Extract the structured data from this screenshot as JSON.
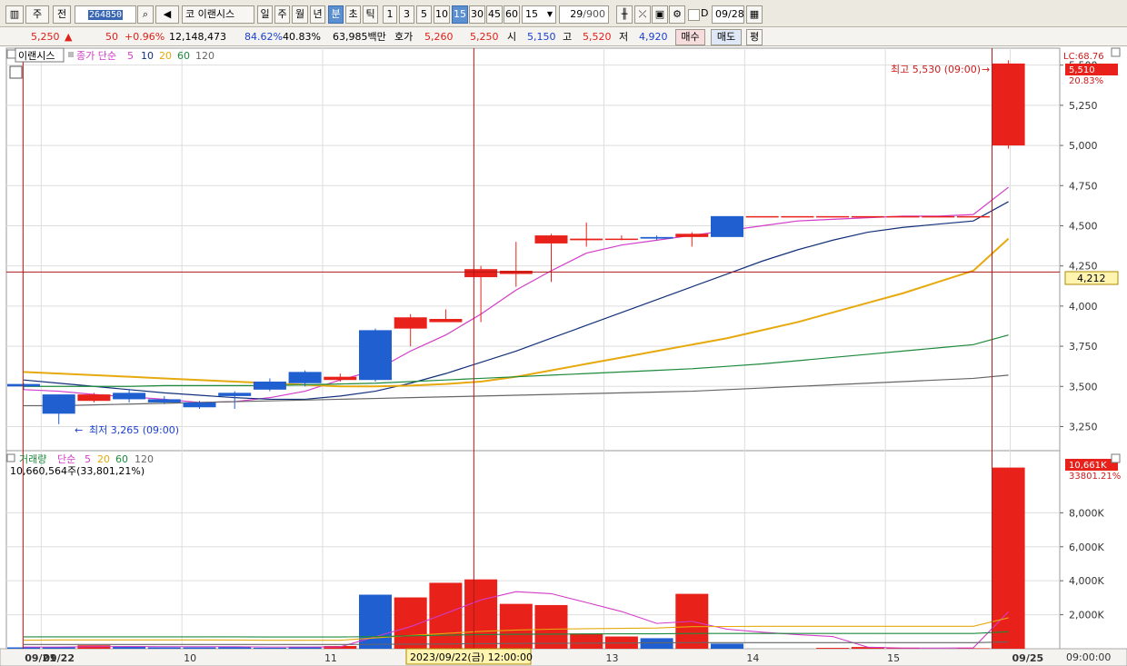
{
  "toolbar": {
    "market": "주",
    "prev_label": "전",
    "code": "264850",
    "company_prefix": "코",
    "company": "이랜시스",
    "periods": [
      "일",
      "주",
      "월",
      "년",
      "분",
      "초",
      "틱"
    ],
    "active_period": "분",
    "intervals": [
      "1",
      "3",
      "5",
      "10",
      "15",
      "30",
      "45",
      "60"
    ],
    "active_interval": "15",
    "interval_select": "15",
    "count": "29",
    "count_max": "/900",
    "d_label": "D",
    "date": "09/28"
  },
  "quote": {
    "price": "5,250",
    "arrow": "▲",
    "change": "50",
    "change_pct": "+0.96%",
    "volume": "12,148,473",
    "ratio1": "84.62%",
    "ratio2": "40.83%",
    "amount": "63,985백만",
    "bid_label": "호가",
    "ask_price": "5,260",
    "bid_price": "5,250",
    "open_label": "시",
    "open": "5,150",
    "high_label": "고",
    "high": "5,520",
    "low_label": "저",
    "low": "4,920",
    "buy": "매수",
    "sell": "매도",
    "avg": "평"
  },
  "legend": {
    "price_name": "이랜시스",
    "price_ma_title": "종가 단순",
    "ma": [
      "5",
      "10",
      "20",
      "60",
      "120"
    ],
    "volume_name": "거래량",
    "volume_ma_title": "단순",
    "volume_ma": [
      "5",
      "20",
      "60",
      "120"
    ],
    "volume_info": "10,660,564주(33,801,21%)"
  },
  "annotations": {
    "high": "최고 5,530 (09:00)",
    "low": "최저 3,265 (09:00)",
    "lc": "LC:68.76",
    "price_tag": "5,510",
    "price_tag_pct": "20.83%",
    "crosshair_value": "4,212",
    "crosshair_time": "2023/09/22(금) 12:00:00",
    "volume_tag": "10,661K",
    "volume_tag_pct": "33801.21%",
    "time_axis_corner": "09:00:00"
  },
  "colors": {
    "up": "#e8211a",
    "down": "#1f5fd0",
    "ma5": "#d23cc8",
    "ma10": "#12307a",
    "ma20": "#e6a90e",
    "ma60": "#1d8a3c",
    "ma120": "#666666",
    "grid": "#dddddd",
    "crosshair": "#b01818"
  },
  "chart_data": [
    {
      "type": "candlestick",
      "title": "이랜시스 15분봉",
      "x": [
        "09/21 15:00",
        "09/22 09:00",
        "09/22 09:15",
        "09/22 09:30",
        "09/22 09:45",
        "09/22 10:00",
        "09/22 10:15",
        "09/22 10:30",
        "09/22 10:45",
        "09/22 11:00",
        "09/22 11:15",
        "09/22 11:30",
        "09/22 11:45",
        "09/22 12:00",
        "09/22 12:15",
        "09/22 12:30",
        "09/22 12:45",
        "09/22 13:00",
        "09/22 13:15",
        "09/22 13:30",
        "09/22 13:45",
        "09/22 14:00",
        "09/22 14:15",
        "09/22 14:30",
        "09/22 14:45",
        "09/22 15:00",
        "09/22 15:15",
        "09/22 15:30",
        "09/25 09:00"
      ],
      "open": [
        3515,
        3450,
        3410,
        3460,
        3420,
        3400,
        3460,
        3530,
        3590,
        3540,
        3850,
        3860,
        3900,
        4180,
        4200,
        4390,
        4410,
        4420,
        4430,
        4430,
        4560,
        4560,
        4560,
        4560,
        4560,
        4560,
        4560,
        4560,
        5000
      ],
      "close": [
        3500,
        3330,
        3450,
        3420,
        3400,
        3370,
        3440,
        3480,
        3520,
        3560,
        3540,
        3930,
        3920,
        4230,
        4220,
        4440,
        4420,
        4420,
        4420,
        4450,
        4430,
        4560,
        4560,
        4560,
        4560,
        4560,
        4560,
        4560,
        5510
      ],
      "high": [
        3520,
        3450,
        3460,
        3480,
        3440,
        3410,
        3470,
        3550,
        3600,
        3580,
        3860,
        3950,
        3980,
        4250,
        4400,
        4450,
        4520,
        4440,
        4440,
        4460,
        4560,
        4560,
        4560,
        4560,
        4560,
        4560,
        4560,
        4560,
        5530
      ],
      "low": [
        3480,
        3265,
        3400,
        3400,
        3390,
        3360,
        3360,
        3470,
        3500,
        3530,
        3530,
        3750,
        3900,
        3900,
        4120,
        4150,
        4370,
        4410,
        4410,
        4370,
        4430,
        4560,
        4560,
        4560,
        4560,
        4560,
        4560,
        4560,
        4980
      ],
      "ma": {
        "5": [
          3480,
          3470,
          3450,
          3435,
          3420,
          3400,
          3405,
          3430,
          3470,
          3540,
          3600,
          3720,
          3820,
          3950,
          4100,
          4220,
          4330,
          4380,
          4410,
          4440,
          4470,
          4500,
          4530,
          4540,
          4550,
          4560,
          4560,
          4570,
          4740
        ],
        "10": [
          3540,
          3520,
          3500,
          3480,
          3460,
          3445,
          3430,
          3420,
          3420,
          3440,
          3470,
          3520,
          3580,
          3650,
          3720,
          3800,
          3880,
          3960,
          4040,
          4120,
          4200,
          4280,
          4350,
          4410,
          4460,
          4490,
          4510,
          4530,
          4650
        ],
        "20": [
          3590,
          3580,
          3570,
          3560,
          3550,
          3540,
          3530,
          3520,
          3510,
          3500,
          3500,
          3505,
          3515,
          3530,
          3560,
          3600,
          3640,
          3680,
          3720,
          3760,
          3800,
          3850,
          3900,
          3960,
          4020,
          4080,
          4150,
          4220,
          4420
        ],
        "60": [
          3500,
          3500,
          3500,
          3500,
          3505,
          3505,
          3505,
          3505,
          3510,
          3515,
          3520,
          3530,
          3540,
          3550,
          3560,
          3570,
          3580,
          3590,
          3600,
          3610,
          3625,
          3640,
          3660,
          3680,
          3700,
          3720,
          3740,
          3760,
          3820
        ],
        "120": [
          3380,
          3380,
          3385,
          3390,
          3395,
          3400,
          3405,
          3410,
          3415,
          3420,
          3425,
          3430,
          3435,
          3440,
          3445,
          3450,
          3455,
          3460,
          3465,
          3470,
          3480,
          3490,
          3500,
          3510,
          3520,
          3530,
          3540,
          3550,
          3570
        ]
      },
      "xlabel": "",
      "ylabel": "",
      "ylim": [
        3100,
        5600
      ],
      "yticks": [
        "3,250",
        "3,500",
        "3,750",
        "4,000",
        "4,250",
        "4,500",
        "4,750",
        "5,000",
        "5,250",
        "5,500"
      ],
      "grid": true
    },
    {
      "type": "bar",
      "title": "거래량",
      "values": [
        80000,
        100000,
        200000,
        150000,
        80000,
        80000,
        100000,
        60000,
        120000,
        160000,
        3180000,
        3020000,
        3880000,
        4080000,
        2640000,
        2570000,
        900000,
        720000,
        620000,
        3230000,
        300000,
        0,
        0,
        50000,
        100000,
        60000,
        0,
        30000,
        10661000
      ],
      "ma": {
        "5": [
          100000,
          100000,
          120000,
          130000,
          120000,
          120000,
          120000,
          100000,
          100000,
          110000,
          710000,
          1300000,
          2080000,
          2870000,
          3360000,
          3240000,
          2720000,
          2190000,
          1490000,
          1610000,
          1150000,
          970000,
          830000,
          720000,
          90000,
          40000,
          40000,
          50000,
          2180000
        ],
        "20": [
          500000,
          520000,
          520000,
          520000,
          520000,
          520000,
          510000,
          500000,
          500000,
          500000,
          640000,
          780000,
          900000,
          1020000,
          1100000,
          1150000,
          1180000,
          1200000,
          1220000,
          1300000,
          1310000,
          1320000,
          1320000,
          1320000,
          1320000,
          1320000,
          1320000,
          1320000,
          1820000
        ],
        "60": [
          700000,
          700000,
          700000,
          700000,
          700000,
          700000,
          700000,
          690000,
          690000,
          690000,
          720000,
          760000,
          800000,
          830000,
          850000,
          860000,
          870000,
          880000,
          880000,
          900000,
          900000,
          900000,
          900000,
          900000,
          900000,
          900000,
          900000,
          900000,
          1000000
        ],
        "120": [
          250000,
          250000,
          250000,
          250000,
          250000,
          250000,
          250000,
          250000,
          250000,
          250000,
          260000,
          270000,
          280000,
          300000,
          310000,
          320000,
          330000,
          340000,
          350000,
          360000,
          360000,
          360000,
          360000,
          360000,
          360000,
          360000,
          360000,
          360000,
          400000
        ]
      },
      "ylim": [
        0,
        10800000
      ],
      "yticks": [
        "2,000K",
        "4,000K",
        "6,000K",
        "8,000K"
      ],
      "grid": true
    }
  ],
  "time_axis": {
    "labels": [
      {
        "text": "09/21",
        "idx": -0.02
      },
      {
        "text": "09/22",
        "idx": 0.5
      },
      {
        "text": "10",
        "idx": 4.5
      },
      {
        "text": "11",
        "idx": 8.5
      },
      {
        "text": "13",
        "idx": 16.5
      },
      {
        "text": "14",
        "idx": 20.5
      },
      {
        "text": "15",
        "idx": 24.5
      },
      {
        "text": "09/25",
        "idx": 28.05
      }
    ]
  }
}
